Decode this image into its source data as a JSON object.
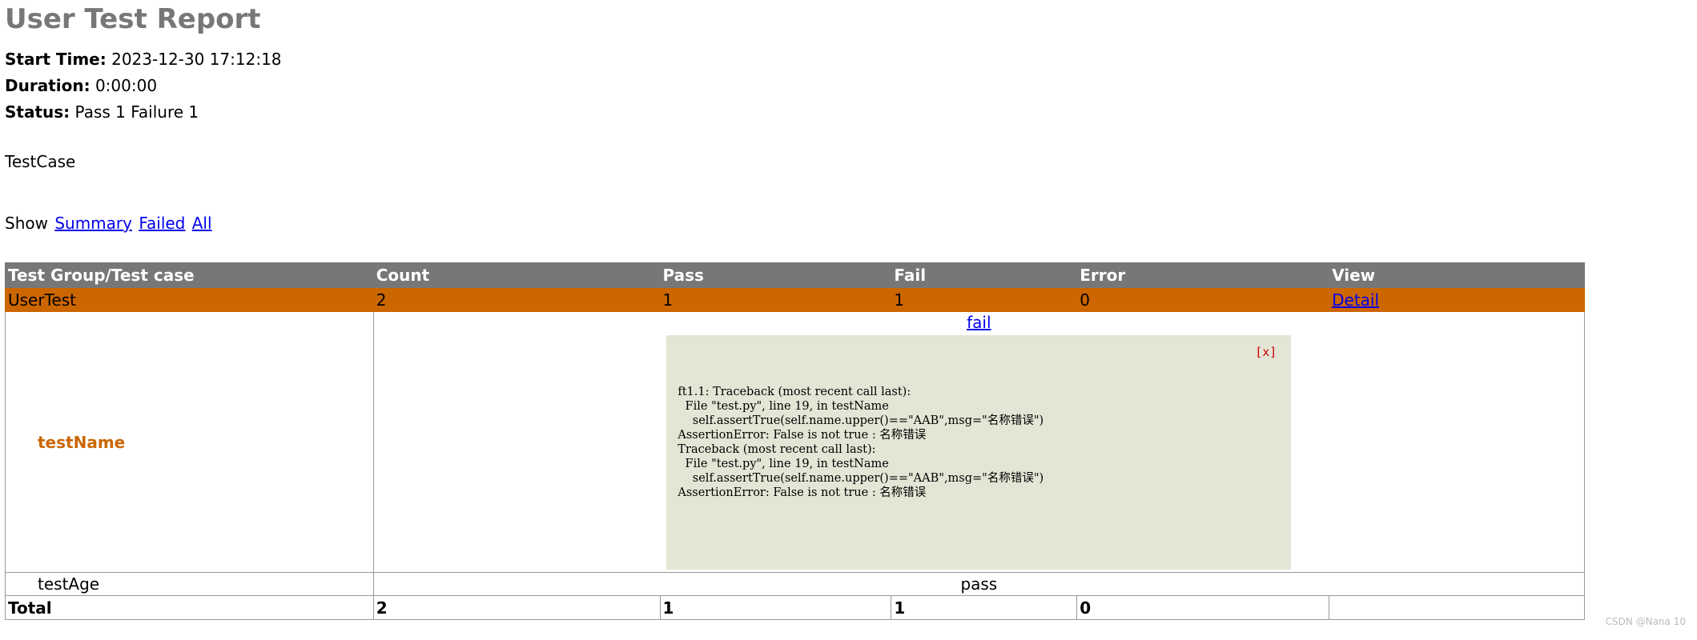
{
  "report": {
    "title": "User Test Report",
    "start_time_label": "Start Time:",
    "start_time": "2023-12-30 17:12:18",
    "duration_label": "Duration:",
    "duration": "0:00:00",
    "status_label": "Status:",
    "status": "Pass 1 Failure 1",
    "description": "TestCase"
  },
  "show": {
    "label": "Show",
    "summary": "Summary",
    "failed": "Failed",
    "all": "All"
  },
  "table": {
    "headers": [
      "Test Group/Test case",
      "Count",
      "Pass",
      "Fail",
      "Error",
      "View"
    ],
    "group": {
      "name": "UserTest",
      "count": "2",
      "pass": "1",
      "fail": "1",
      "error": "0",
      "view": "Detail"
    },
    "cases": [
      {
        "name": "testName",
        "result": "fail",
        "close": "[x]",
        "traceback": "ft1.1: Traceback (most recent call last):\n  File \"test.py\", line 19, in testName\n    self.assertTrue(self.name.upper()==\"AAB\",msg=\"名称错误\")\nAssertionError: False is not true : 名称错误\nTraceback (most recent call last):\n  File \"test.py\", line 19, in testName\n    self.assertTrue(self.name.upper()==\"AAB\",msg=\"名称错误\")\nAssertionError: False is not true : 名称错误"
      },
      {
        "name": "testAge",
        "result": "pass"
      }
    ],
    "total": {
      "label": "Total",
      "count": "2",
      "pass": "1",
      "fail": "1",
      "error": "0"
    }
  },
  "watermark": "CSDN @Nana 10"
}
